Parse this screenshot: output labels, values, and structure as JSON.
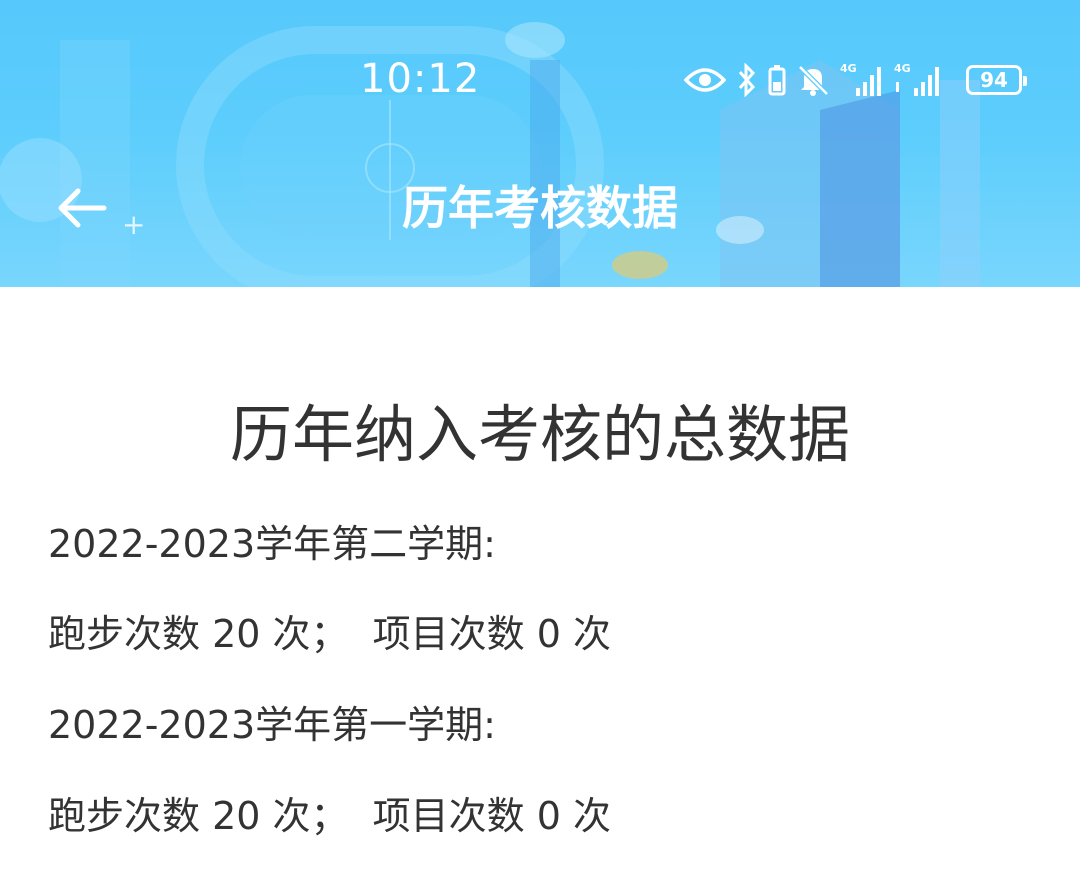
{
  "status_bar": {
    "time": "10:12",
    "signal_1_label": "4G",
    "signal_2_label": "4G",
    "battery_level": "94"
  },
  "nav": {
    "title": "历年考核数据"
  },
  "summary": {
    "heading": "历年纳入考核的总数据",
    "terms": [
      {
        "term_label": "2022-2023学年第二学期:",
        "stats_line": "跑步次数 20 次；  项目次数 0 次"
      },
      {
        "term_label": "2022-2023学年第一学期:",
        "stats_line": "跑步次数 20 次；  项目次数 0 次"
      }
    ]
  }
}
